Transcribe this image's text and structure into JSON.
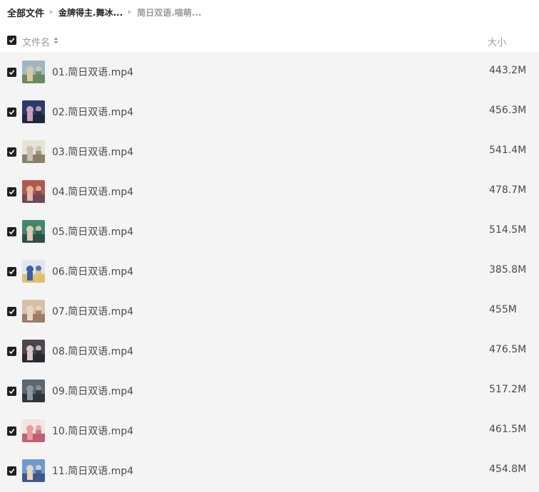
{
  "breadcrumb": {
    "root": "全部文件",
    "folder": "金牌得主.舞冰...",
    "current": "简日双语.喵萌..."
  },
  "header": {
    "name_label": "文件名",
    "size_label": "大小"
  },
  "files": [
    {
      "name": "01.简日双语.mp4",
      "size": "443.2M",
      "thumb_colors": [
        "#9fb6c4",
        "#d9c9a3",
        "#6b8a5e"
      ]
    },
    {
      "name": "02.简日双语.mp4",
      "size": "456.3M",
      "thumb_colors": [
        "#2b3a6b",
        "#c9a0b8",
        "#1f2740"
      ]
    },
    {
      "name": "03.简日双语.mp4",
      "size": "541.4M",
      "thumb_colors": [
        "#e6e2d4",
        "#c7c1ad",
        "#8a7f6a"
      ]
    },
    {
      "name": "04.简日双语.mp4",
      "size": "478.7M",
      "thumb_colors": [
        "#b05a4c",
        "#e2b8a2",
        "#6d4a57"
      ]
    },
    {
      "name": "05.简日双语.mp4",
      "size": "514.5M",
      "thumb_colors": [
        "#3d8a6e",
        "#e0c9b4",
        "#2f5248"
      ]
    },
    {
      "name": "06.简日双语.mp4",
      "size": "385.8M",
      "thumb_colors": [
        "#dfe6ef",
        "#3b5ea8",
        "#e0c070"
      ]
    },
    {
      "name": "07.简日双语.mp4",
      "size": "455M",
      "thumb_colors": [
        "#d8c0a8",
        "#e8d6c4",
        "#9a7a6a"
      ]
    },
    {
      "name": "08.简日双语.mp4",
      "size": "476.5M",
      "thumb_colors": [
        "#4a4650",
        "#d6c8c0",
        "#2c2a30"
      ]
    },
    {
      "name": "09.简日双语.mp4",
      "size": "517.2M",
      "thumb_colors": [
        "#5c6670",
        "#8d97a0",
        "#2f353b"
      ]
    },
    {
      "name": "10.简日双语.mp4",
      "size": "461.5M",
      "thumb_colors": [
        "#f2e6e0",
        "#e89aa0",
        "#c06070"
      ]
    },
    {
      "name": "11.简日双语.mp4",
      "size": "454.8M",
      "thumb_colors": [
        "#6f9ad0",
        "#e6d4c0",
        "#3a5a8a"
      ]
    }
  ],
  "icons": {
    "checkbox": "check-icon",
    "sort": "sort-icon",
    "separator": "chevron-right-icon"
  },
  "colors": {
    "checkbox": "#1f1f1f",
    "list_bg": "#f4f4f4",
    "header_text": "#999999"
  }
}
